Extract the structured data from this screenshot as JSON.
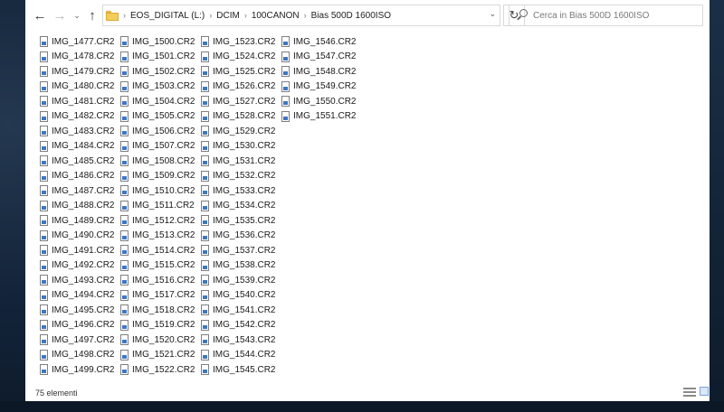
{
  "toolbar": {
    "back_icon": "arrow-left-icon",
    "forward_icon": "arrow-right-icon",
    "recent_icon": "chevron-down-icon",
    "up_icon": "arrow-up-icon",
    "breadcrumbs": [
      "EOS_DIGITAL (L:)",
      "DCIM",
      "100CANON",
      "Bias 500D 1600ISO"
    ],
    "refresh_icon": "refresh-icon"
  },
  "search": {
    "placeholder": "Cerca in Bias 500D 1600ISO"
  },
  "files": {
    "col1": [
      "IMG_1477.CR2",
      "IMG_1478.CR2",
      "IMG_1479.CR2",
      "IMG_1480.CR2",
      "IMG_1481.CR2",
      "IMG_1482.CR2",
      "IMG_1483.CR2",
      "IMG_1484.CR2",
      "IMG_1485.CR2",
      "IMG_1486.CR2",
      "IMG_1487.CR2",
      "IMG_1488.CR2",
      "IMG_1489.CR2",
      "IMG_1490.CR2",
      "IMG_1491.CR2",
      "IMG_1492.CR2",
      "IMG_1493.CR2",
      "IMG_1494.CR2",
      "IMG_1495.CR2",
      "IMG_1496.CR2",
      "IMG_1497.CR2",
      "IMG_1498.CR2",
      "IMG_1499.CR2"
    ],
    "col2": [
      "IMG_1500.CR2",
      "IMG_1501.CR2",
      "IMG_1502.CR2",
      "IMG_1503.CR2",
      "IMG_1504.CR2",
      "IMG_1505.CR2",
      "IMG_1506.CR2",
      "IMG_1507.CR2",
      "IMG_1508.CR2",
      "IMG_1509.CR2",
      "IMG_1510.CR2",
      "IMG_1511.CR2",
      "IMG_1512.CR2",
      "IMG_1513.CR2",
      "IMG_1514.CR2",
      "IMG_1515.CR2",
      "IMG_1516.CR2",
      "IMG_1517.CR2",
      "IMG_1518.CR2",
      "IMG_1519.CR2",
      "IMG_1520.CR2",
      "IMG_1521.CR2",
      "IMG_1522.CR2"
    ],
    "col3": [
      "IMG_1523.CR2",
      "IMG_1524.CR2",
      "IMG_1525.CR2",
      "IMG_1526.CR2",
      "IMG_1527.CR2",
      "IMG_1528.CR2",
      "IMG_1529.CR2",
      "IMG_1530.CR2",
      "IMG_1531.CR2",
      "IMG_1532.CR2",
      "IMG_1533.CR2",
      "IMG_1534.CR2",
      "IMG_1535.CR2",
      "IMG_1536.CR2",
      "IMG_1537.CR2",
      "IMG_1538.CR2",
      "IMG_1539.CR2",
      "IMG_1540.CR2",
      "IMG_1541.CR2",
      "IMG_1542.CR2",
      "IMG_1543.CR2",
      "IMG_1544.CR2",
      "IMG_1545.CR2"
    ],
    "col4": [
      "IMG_1546.CR2",
      "IMG_1547.CR2",
      "IMG_1548.CR2",
      "IMG_1549.CR2",
      "IMG_1550.CR2",
      "IMG_1551.CR2"
    ]
  },
  "status": {
    "count_text": "75 elementi"
  },
  "colors": {
    "window": "#ffffff",
    "desktop": "#0f1d2c",
    "file_icon_accent": "#3d77c4"
  }
}
